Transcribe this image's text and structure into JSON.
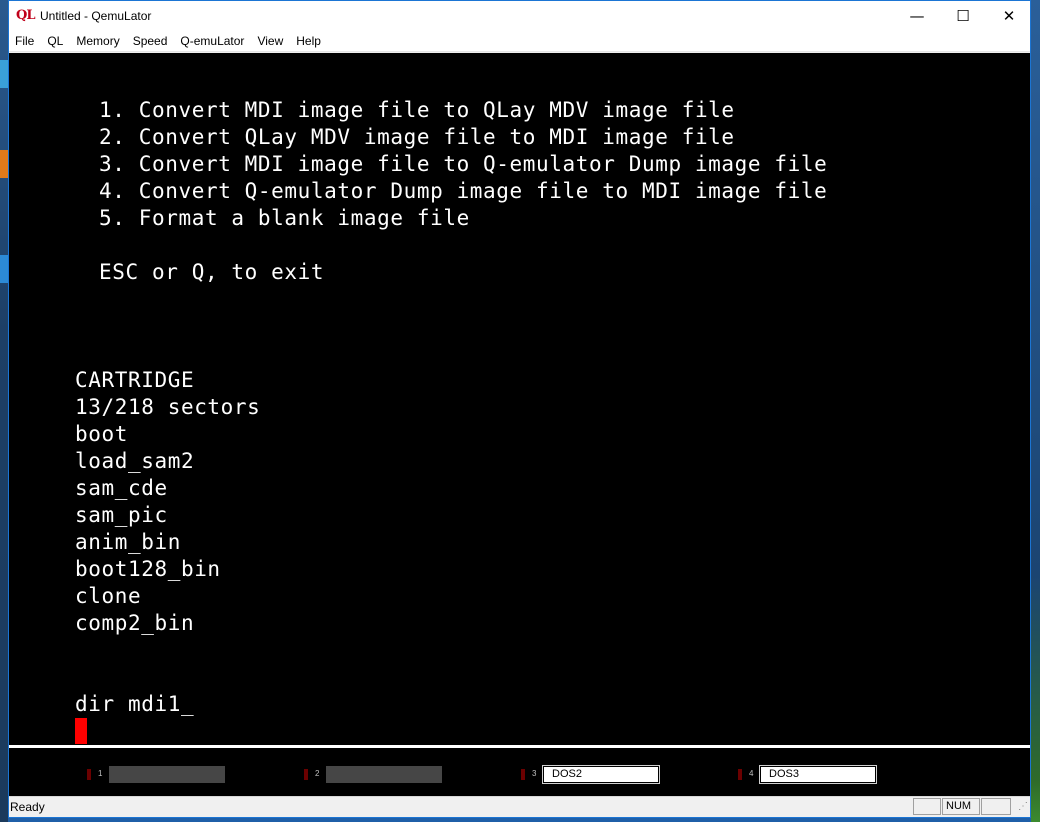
{
  "window": {
    "title": "Untitled - QemuLator",
    "app_icon": "QL",
    "minimize_glyph": "—",
    "maximize_glyph": "☐",
    "close_glyph": "✕"
  },
  "menu": [
    "File",
    "QL",
    "Memory",
    "Speed",
    "Q-emuLator",
    "View",
    "Help"
  ],
  "screen": {
    "options": [
      "1. Convert MDI image file to QLay MDV image file",
      "2. Convert QLay MDV image file to MDI image file",
      "3. Convert MDI image file to Q-emulator Dump image file",
      "4. Convert Q-emulator Dump image file to MDI image file",
      "5. Format a blank image file"
    ],
    "exit_hint": "ESC or Q, to exit",
    "listing": [
      "CARTRIDGE",
      "13/218 sectors",
      "boot",
      "load_sam2",
      "sam_cde",
      "sam_pic",
      "anim_bin",
      "boot128_bin",
      "clone",
      "comp2_bin"
    ],
    "command": "dir mdi1_"
  },
  "drives": [
    {
      "number": "1",
      "label": ""
    },
    {
      "number": "2",
      "label": ""
    },
    {
      "number": "3",
      "label": "DOS2"
    },
    {
      "number": "4",
      "label": "DOS3"
    }
  ],
  "status": {
    "text": "Ready",
    "num": "NUM"
  }
}
